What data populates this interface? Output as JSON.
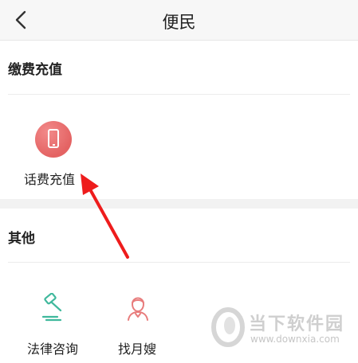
{
  "header": {
    "title": "便民",
    "back_icon": "chevron-left-icon"
  },
  "sections": {
    "payment": {
      "title": "缴费充值",
      "items": [
        {
          "label": "话费充值",
          "icon": "phone-icon",
          "icon_color": "#e46363"
        }
      ]
    },
    "other": {
      "title": "其他",
      "items": [
        {
          "label": "法律咨询",
          "icon": "gavel-icon",
          "icon_color": "#3fb89c"
        },
        {
          "label": "找月嫂",
          "icon": "nanny-icon",
          "icon_color": "#e87c7c"
        }
      ]
    }
  },
  "annotation": {
    "arrow_color": "#ee1c1c",
    "type": "red-arrow-pointer"
  },
  "watermark": {
    "name": "当下软件园",
    "url": "www.downxia.com"
  }
}
